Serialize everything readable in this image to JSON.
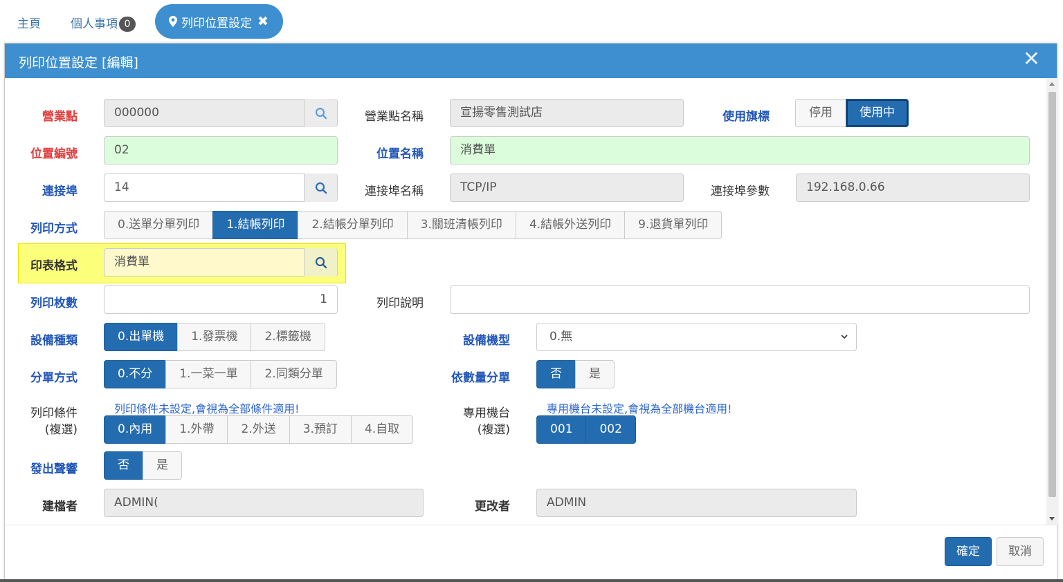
{
  "tabs": {
    "home": "主頁",
    "personal": "個人事項",
    "personal_count": "0",
    "active": "列印位置設定",
    "active_close": "✖"
  },
  "modal": {
    "title": "列印位置設定 [編輯]",
    "close": "✕"
  },
  "form": {
    "store": {
      "label": "營業點",
      "value": "000000"
    },
    "store_name": {
      "label": "營業點名稱",
      "value": "宣揚零售測試店"
    },
    "use_flag": {
      "label": "使用旗標",
      "options": [
        "停用",
        "使用中"
      ],
      "selected": "使用中"
    },
    "position_no": {
      "label": "位置編號",
      "value": "02"
    },
    "position_name": {
      "label": "位置名稱",
      "value": "消費單"
    },
    "port": {
      "label": "連接埠",
      "value": "14"
    },
    "port_name": {
      "label": "連接埠名稱",
      "value": "TCP/IP"
    },
    "port_param": {
      "label": "連接埠參數",
      "value": "192.168.0.66"
    },
    "print_mode": {
      "label": "列印方式",
      "options": [
        "0.送單分單列印",
        "1.結帳列印",
        "2.結帳分單列印",
        "3.關班清帳列印",
        "4.結帳外送列印",
        "9.退貨單列印"
      ],
      "selected": "1.結帳列印"
    },
    "report_format": {
      "label": "印表格式",
      "value": "消費單"
    },
    "copies": {
      "label": "列印枚數",
      "value": "1"
    },
    "print_desc": {
      "label": "列印說明",
      "value": ""
    },
    "device_type": {
      "label": "設備種類",
      "options": [
        "0.出單機",
        "1.發票機",
        "2.標籤機"
      ],
      "selected": "0.出單機"
    },
    "device_model": {
      "label": "設備機型",
      "value": "0.無"
    },
    "split_mode": {
      "label": "分單方式",
      "options": [
        "0.不分",
        "1.一菜一單",
        "2.同類分單"
      ],
      "selected": "0.不分"
    },
    "split_by_qty": {
      "label": "依數量分單",
      "options": [
        "否",
        "是"
      ],
      "selected": "否"
    },
    "print_cond": {
      "label_line1": "列印條件",
      "label_line2": "(複選)",
      "hint": "列印條件未設定,會視為全部條件適用!",
      "options": [
        "0.內用",
        "1.外帶",
        "2.外送",
        "3.預訂",
        "4.自取"
      ],
      "selected": [
        "0.內用"
      ]
    },
    "dedicated_station": {
      "label_line1": "專用機台",
      "label_line2": "(複選)",
      "hint": "專用機台未設定,會視為全部機台適用!",
      "options": [
        "001",
        "002"
      ],
      "selected": [
        "001",
        "002"
      ]
    },
    "beep": {
      "label": "發出聲響",
      "options": [
        "否",
        "是"
      ],
      "selected": "否"
    },
    "creator": {
      "label": "建檔者",
      "value": "ADMIN("
    },
    "modifier": {
      "label": "更改者",
      "value": "ADMIN"
    }
  },
  "footer": {
    "confirm": "確定",
    "cancel": "取消"
  },
  "colors": {
    "header": "#3d8fcf",
    "primary": "#246cb0",
    "required_label": "#e33d3d",
    "label_blue": "#2357b8",
    "highlight": "#fbff7a",
    "green_field": "#dcfddc"
  },
  "icons": {
    "search": "search-icon",
    "pin": "map-pin-icon",
    "close": "close-icon",
    "chevron": "chevron-down-icon"
  }
}
